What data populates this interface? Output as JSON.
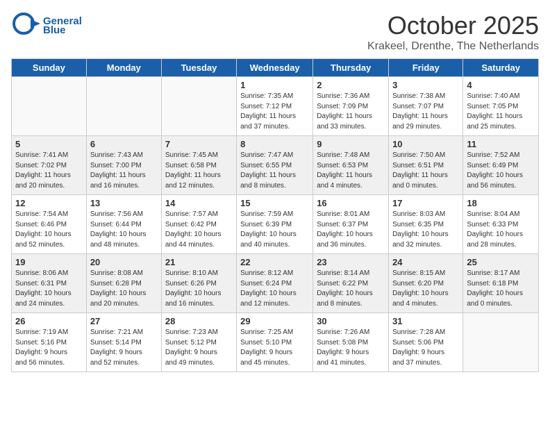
{
  "header": {
    "logo_line1": "General",
    "logo_line2": "Blue",
    "month": "October 2025",
    "location": "Krakeel, Drenthe, The Netherlands"
  },
  "weekdays": [
    "Sunday",
    "Monday",
    "Tuesday",
    "Wednesday",
    "Thursday",
    "Friday",
    "Saturday"
  ],
  "weeks": [
    [
      {
        "day": "",
        "info": ""
      },
      {
        "day": "",
        "info": ""
      },
      {
        "day": "",
        "info": ""
      },
      {
        "day": "1",
        "info": "Sunrise: 7:35 AM\nSunset: 7:12 PM\nDaylight: 11 hours\nand 37 minutes."
      },
      {
        "day": "2",
        "info": "Sunrise: 7:36 AM\nSunset: 7:09 PM\nDaylight: 11 hours\nand 33 minutes."
      },
      {
        "day": "3",
        "info": "Sunrise: 7:38 AM\nSunset: 7:07 PM\nDaylight: 11 hours\nand 29 minutes."
      },
      {
        "day": "4",
        "info": "Sunrise: 7:40 AM\nSunset: 7:05 PM\nDaylight: 11 hours\nand 25 minutes."
      }
    ],
    [
      {
        "day": "5",
        "info": "Sunrise: 7:41 AM\nSunset: 7:02 PM\nDaylight: 11 hours\nand 20 minutes."
      },
      {
        "day": "6",
        "info": "Sunrise: 7:43 AM\nSunset: 7:00 PM\nDaylight: 11 hours\nand 16 minutes."
      },
      {
        "day": "7",
        "info": "Sunrise: 7:45 AM\nSunset: 6:58 PM\nDaylight: 11 hours\nand 12 minutes."
      },
      {
        "day": "8",
        "info": "Sunrise: 7:47 AM\nSunset: 6:55 PM\nDaylight: 11 hours\nand 8 minutes."
      },
      {
        "day": "9",
        "info": "Sunrise: 7:48 AM\nSunset: 6:53 PM\nDaylight: 11 hours\nand 4 minutes."
      },
      {
        "day": "10",
        "info": "Sunrise: 7:50 AM\nSunset: 6:51 PM\nDaylight: 11 hours\nand 0 minutes."
      },
      {
        "day": "11",
        "info": "Sunrise: 7:52 AM\nSunset: 6:49 PM\nDaylight: 10 hours\nand 56 minutes."
      }
    ],
    [
      {
        "day": "12",
        "info": "Sunrise: 7:54 AM\nSunset: 6:46 PM\nDaylight: 10 hours\nand 52 minutes."
      },
      {
        "day": "13",
        "info": "Sunrise: 7:56 AM\nSunset: 6:44 PM\nDaylight: 10 hours\nand 48 minutes."
      },
      {
        "day": "14",
        "info": "Sunrise: 7:57 AM\nSunset: 6:42 PM\nDaylight: 10 hours\nand 44 minutes."
      },
      {
        "day": "15",
        "info": "Sunrise: 7:59 AM\nSunset: 6:39 PM\nDaylight: 10 hours\nand 40 minutes."
      },
      {
        "day": "16",
        "info": "Sunrise: 8:01 AM\nSunset: 6:37 PM\nDaylight: 10 hours\nand 36 minutes."
      },
      {
        "day": "17",
        "info": "Sunrise: 8:03 AM\nSunset: 6:35 PM\nDaylight: 10 hours\nand 32 minutes."
      },
      {
        "day": "18",
        "info": "Sunrise: 8:04 AM\nSunset: 6:33 PM\nDaylight: 10 hours\nand 28 minutes."
      }
    ],
    [
      {
        "day": "19",
        "info": "Sunrise: 8:06 AM\nSunset: 6:31 PM\nDaylight: 10 hours\nand 24 minutes."
      },
      {
        "day": "20",
        "info": "Sunrise: 8:08 AM\nSunset: 6:28 PM\nDaylight: 10 hours\nand 20 minutes."
      },
      {
        "day": "21",
        "info": "Sunrise: 8:10 AM\nSunset: 6:26 PM\nDaylight: 10 hours\nand 16 minutes."
      },
      {
        "day": "22",
        "info": "Sunrise: 8:12 AM\nSunset: 6:24 PM\nDaylight: 10 hours\nand 12 minutes."
      },
      {
        "day": "23",
        "info": "Sunrise: 8:14 AM\nSunset: 6:22 PM\nDaylight: 10 hours\nand 8 minutes."
      },
      {
        "day": "24",
        "info": "Sunrise: 8:15 AM\nSunset: 6:20 PM\nDaylight: 10 hours\nand 4 minutes."
      },
      {
        "day": "25",
        "info": "Sunrise: 8:17 AM\nSunset: 6:18 PM\nDaylight: 10 hours\nand 0 minutes."
      }
    ],
    [
      {
        "day": "26",
        "info": "Sunrise: 7:19 AM\nSunset: 5:16 PM\nDaylight: 9 hours\nand 56 minutes."
      },
      {
        "day": "27",
        "info": "Sunrise: 7:21 AM\nSunset: 5:14 PM\nDaylight: 9 hours\nand 52 minutes."
      },
      {
        "day": "28",
        "info": "Sunrise: 7:23 AM\nSunset: 5:12 PM\nDaylight: 9 hours\nand 49 minutes."
      },
      {
        "day": "29",
        "info": "Sunrise: 7:25 AM\nSunset: 5:10 PM\nDaylight: 9 hours\nand 45 minutes."
      },
      {
        "day": "30",
        "info": "Sunrise: 7:26 AM\nSunset: 5:08 PM\nDaylight: 9 hours\nand 41 minutes."
      },
      {
        "day": "31",
        "info": "Sunrise: 7:28 AM\nSunset: 5:06 PM\nDaylight: 9 hours\nand 37 minutes."
      },
      {
        "day": "",
        "info": ""
      }
    ]
  ]
}
